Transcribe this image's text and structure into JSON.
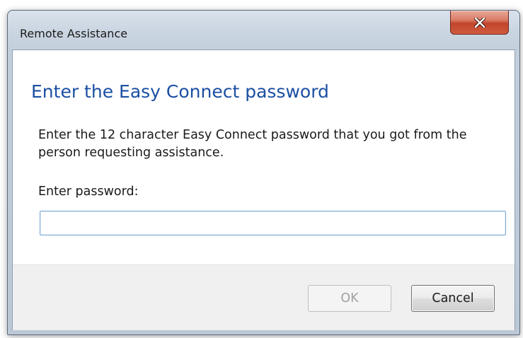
{
  "window": {
    "title": "Remote Assistance",
    "close_icon": "close-icon"
  },
  "dialog": {
    "heading": "Enter the Easy Connect password",
    "description": "Enter the 12 character Easy Connect password that you got from the person requesting assistance.",
    "password_label": "Enter password:",
    "password_value": "",
    "ok_label": "OK",
    "cancel_label": "Cancel",
    "ok_enabled": false
  },
  "colors": {
    "heading": "#1b4fa3",
    "close_button": "#c2452c",
    "input_border": "#7ea9d6"
  }
}
